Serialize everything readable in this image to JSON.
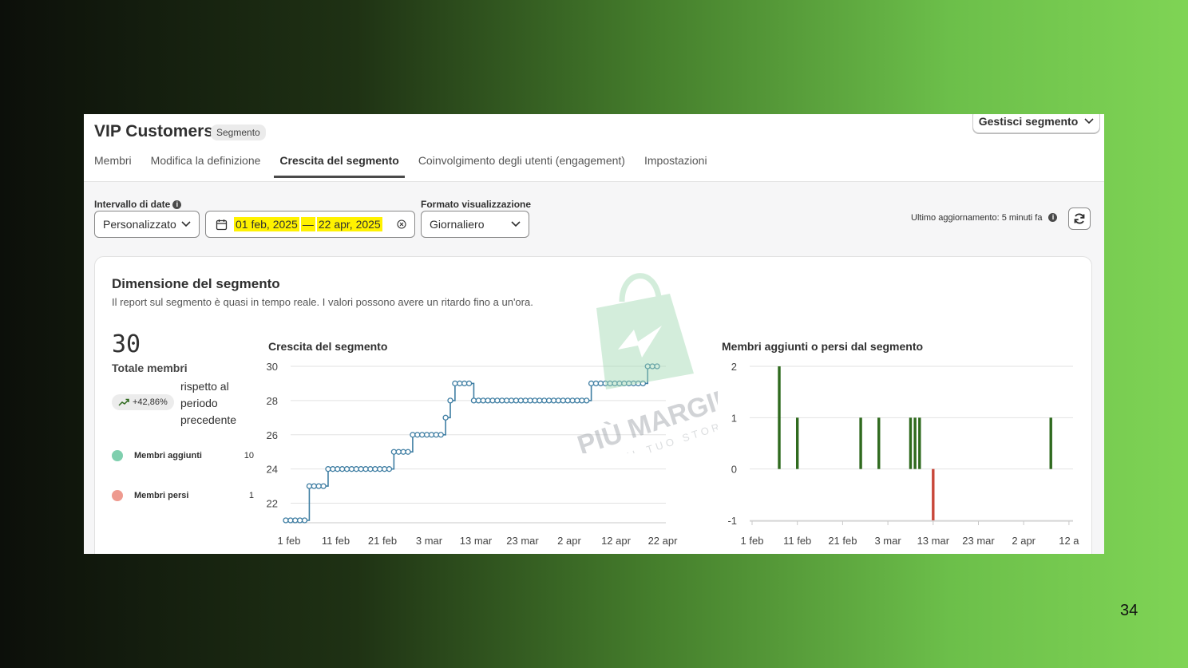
{
  "header": {
    "title": "VIP Customers",
    "badge": "Segmento",
    "manage_label": "Gestisci segmento"
  },
  "tabs": [
    {
      "label": "Membri",
      "active": false
    },
    {
      "label": "Modifica la definizione",
      "active": false
    },
    {
      "label": "Crescita del segmento",
      "active": true
    },
    {
      "label": "Coinvolgimento degli utenti (engagement)",
      "active": false
    },
    {
      "label": "Impostazioni",
      "active": false
    }
  ],
  "controls": {
    "date_range_label": "Intervallo di date",
    "range_preset": "Personalizzato",
    "date_start": "01 feb, 2025",
    "date_sep": "—",
    "date_end": "22 apr, 2025",
    "format_label": "Formato visualizzazione",
    "format_value": "Giornaliero",
    "last_update": "Ultimo aggiornamento: 5 minuti fa"
  },
  "card": {
    "title": "Dimensione del segmento",
    "subtitle": "Il report sul segmento è quasi in tempo reale. I valori possono avere un ritardo fino a un'ora.",
    "total": "30",
    "total_label": "Totale membri",
    "change": "+42,86%",
    "compare_text": "rispetto al periodo precedente",
    "legend": [
      {
        "label": "Membri aggiunti",
        "value": "10",
        "color": "#7fcfae"
      },
      {
        "label": "Membri persi",
        "value": "1",
        "color": "#ee9a8f"
      }
    ]
  },
  "icons": {
    "info": "info-icon",
    "calendar": "calendar-icon",
    "clear": "clear-icon",
    "chevron": "chevron-down-icon",
    "refresh": "refresh-icon",
    "trend": "trend-up-icon"
  },
  "chart_data": [
    {
      "type": "line",
      "title": "Crescita del segmento",
      "x_ticks": [
        "1 feb",
        "11 feb",
        "21 feb",
        "3 mar",
        "13 mar",
        "23 mar",
        "2 apr",
        "12 apr",
        "22 apr"
      ],
      "y_ticks": [
        22,
        24,
        26,
        28,
        30
      ],
      "ylim": [
        21,
        30
      ],
      "color": "#3f7ea3",
      "series": [
        {
          "values": [
            21,
            21,
            21,
            21,
            21,
            23,
            23,
            23,
            23,
            24,
            24,
            24,
            24,
            24,
            24,
            24,
            24,
            24,
            24,
            24,
            24,
            24,
            24,
            25,
            25,
            25,
            25,
            26,
            26,
            26,
            26,
            26,
            26,
            26,
            27,
            28,
            29,
            29,
            29,
            29,
            28,
            28,
            28,
            28,
            28,
            28,
            28,
            28,
            28,
            28,
            28,
            28,
            28,
            28,
            28,
            28,
            28,
            28,
            28,
            28,
            28,
            28,
            28,
            28,
            28,
            29,
            29,
            29,
            29,
            29,
            29,
            29,
            29,
            29,
            29,
            29,
            29,
            30,
            30,
            30
          ]
        }
      ]
    },
    {
      "type": "bar",
      "title": "Membri aggiunti o persi dal segmento",
      "x_ticks": [
        "1 feb",
        "11 feb",
        "21 feb",
        "3 mar",
        "13 mar",
        "23 mar",
        "2 apr",
        "12 a"
      ],
      "y_ticks": [
        -1,
        0,
        1,
        2
      ],
      "ylim": [
        -1,
        2
      ],
      "positive_color": "#2f6a1e",
      "negative_color": "#c8473a",
      "bars": [
        {
          "day": 6,
          "value": 2
        },
        {
          "day": 10,
          "value": 1
        },
        {
          "day": 24,
          "value": 1
        },
        {
          "day": 28,
          "value": 1
        },
        {
          "day": 35,
          "value": 1
        },
        {
          "day": 36,
          "value": 1
        },
        {
          "day": 37,
          "value": 1
        },
        {
          "day": 40,
          "value": -1
        },
        {
          "day": 66,
          "value": 1
        }
      ]
    }
  ],
  "watermark": {
    "brand": "PIÙ MARGINI",
    "tagline": "PER IL TUO STORE"
  },
  "page_number": "34"
}
